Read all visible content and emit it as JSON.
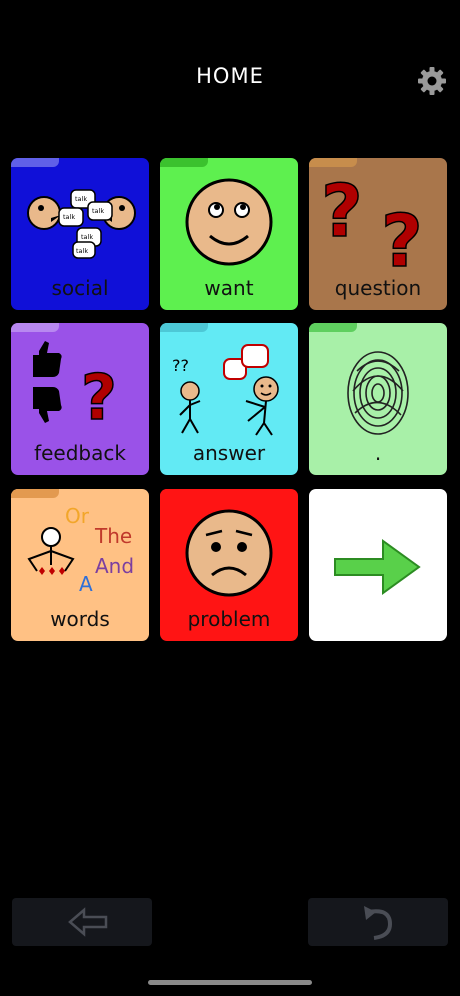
{
  "header": {
    "title": "HOME",
    "settings_icon": "gear-icon"
  },
  "tiles": [
    {
      "label": "social",
      "bg": "#1010d8",
      "tab": "#6060e8",
      "icon": "talking-faces-icon"
    },
    {
      "label": "want",
      "bg": "#5ef04f",
      "tab": "#3bc22e",
      "icon": "smiley-face-icon"
    },
    {
      "label": "question",
      "bg": "#a9764b",
      "tab": "#c78d4c",
      "icon": "question-marks-icon"
    },
    {
      "label": "feedback",
      "bg": "#9a52e8",
      "tab": "#b888f0",
      "icon": "thumbs-question-icon"
    },
    {
      "label": "answer",
      "bg": "#62eaf4",
      "tab": "#4dc8d6",
      "icon": "conversation-icon"
    },
    {
      "label": ".",
      "bg": "#a8f0a8",
      "tab": "#5fcf5f",
      "icon": "fingerprint-icon"
    },
    {
      "label": "words",
      "bg": "#ffc184",
      "tab": "#e39a50",
      "icon": "words-person-icon",
      "words": [
        "Or",
        "The",
        "And",
        "A"
      ]
    },
    {
      "label": "problem",
      "bg": "#ff1414",
      "tab": "#ff1414",
      "icon": "sad-face-icon"
    },
    {
      "label": "",
      "bg": "#ffffff",
      "tab": "#ffffff",
      "icon": "arrow-right-icon"
    }
  ],
  "social_bubbles": [
    "talk",
    "talk",
    "talk",
    "talk",
    "talk"
  ],
  "answer_marks": "??",
  "nav": {
    "back_icon": "back-arrow-icon",
    "undo_icon": "undo-icon"
  }
}
